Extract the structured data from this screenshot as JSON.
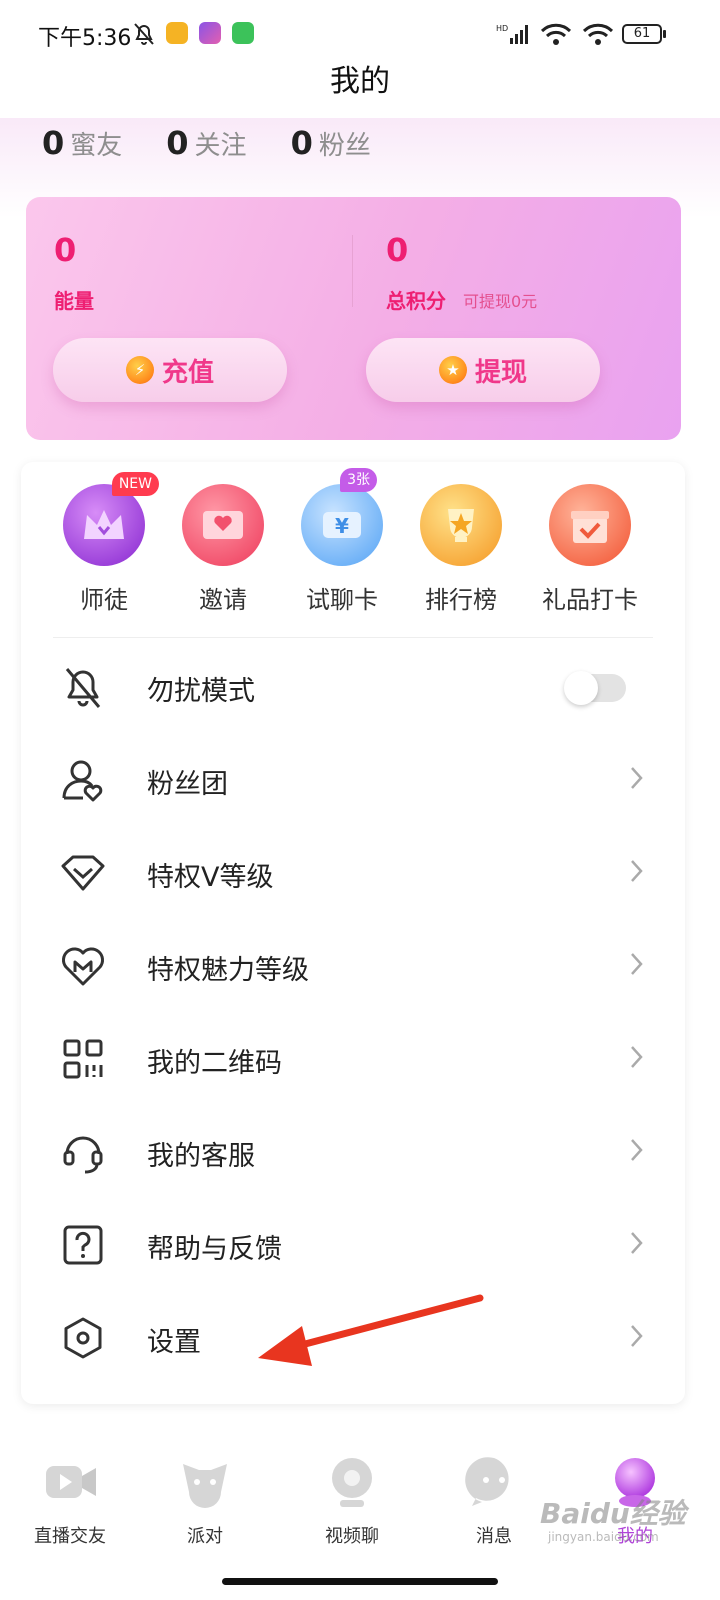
{
  "status_bar": {
    "time": "下午5:36",
    "battery": "61",
    "signal_label": "HD"
  },
  "page_title": "我的",
  "stats": [
    {
      "count": "0",
      "label": "蜜友"
    },
    {
      "count": "0",
      "label": "关注"
    },
    {
      "count": "0",
      "label": "粉丝"
    }
  ],
  "wallet": {
    "energy_value": "0",
    "energy_label": "能量",
    "points_value": "0",
    "points_label": "总积分",
    "withdraw_note": "可提现0元",
    "recharge_label": "充值",
    "withdraw_label": "提现"
  },
  "quick_actions": [
    {
      "label": "师徒",
      "icon": "crown-icon",
      "badge": "NEW"
    },
    {
      "label": "邀请",
      "icon": "heart-envelope-icon",
      "badge": ""
    },
    {
      "label": "试聊卡",
      "icon": "yuan-ticket-icon",
      "badge": "3张"
    },
    {
      "label": "排行榜",
      "icon": "trophy-icon",
      "badge": ""
    },
    {
      "label": "礼品打卡",
      "icon": "gift-box-icon",
      "badge": ""
    }
  ],
  "menu": [
    {
      "label": "勿扰模式",
      "icon": "bell-off-icon",
      "control": "toggle",
      "on": false
    },
    {
      "label": "粉丝团",
      "icon": "fan-club-icon",
      "control": "chevron"
    },
    {
      "label": "特权V等级",
      "icon": "diamond-icon",
      "control": "chevron"
    },
    {
      "label": "特权魅力等级",
      "icon": "heart-m-icon",
      "control": "chevron"
    },
    {
      "label": "我的二维码",
      "icon": "qr-code-icon",
      "control": "chevron"
    },
    {
      "label": "我的客服",
      "icon": "headset-icon",
      "control": "chevron"
    },
    {
      "label": "帮助与反馈",
      "icon": "help-icon",
      "control": "chevron"
    },
    {
      "label": "设置",
      "icon": "settings-hex-icon",
      "control": "chevron"
    }
  ],
  "bottom_nav": [
    {
      "label": "直播交友",
      "icon": "live-camera-icon",
      "active": false
    },
    {
      "label": "派对",
      "icon": "party-icon",
      "active": false
    },
    {
      "label": "视频聊",
      "icon": "webcam-icon",
      "active": false
    },
    {
      "label": "消息",
      "icon": "message-bubble-icon",
      "active": false
    },
    {
      "label": "我的",
      "icon": "profile-orb-icon",
      "active": true
    }
  ],
  "watermark": {
    "text": "Baidu经验",
    "sub": "jingyan.baidu.com"
  },
  "colors": {
    "accent": "#ee1f72",
    "active_nav": "#b044d8",
    "annotation_arrow": "#e8351f"
  }
}
